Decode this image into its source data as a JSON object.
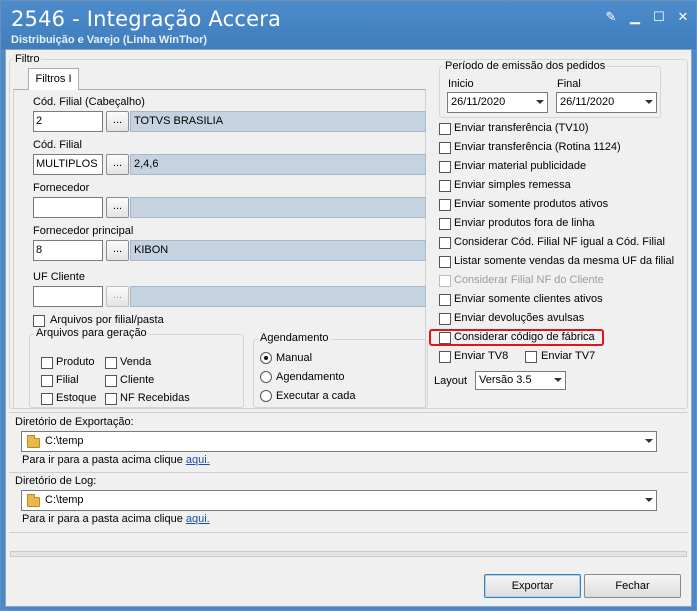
{
  "window": {
    "title": "2546 - Integração Accera",
    "subtitle": "Distribuição e Varejo (Linha WinThor)"
  },
  "filtro": {
    "legend": "Filtro",
    "tab_label": "Filtros I",
    "cod_filial_cab": {
      "label": "Cód. Filial (Cabeçalho)",
      "value": "2",
      "button": "...",
      "description": "TOTVS BRASILIA"
    },
    "cod_filial": {
      "label": "Cód. Filial",
      "value": "MULTIPLOS",
      "button": "...",
      "description": "2,4,6"
    },
    "fornecedor": {
      "label": "Fornecedor",
      "value": "",
      "button": "...",
      "description": ""
    },
    "fornecedor_principal": {
      "label": "Fornecedor principal",
      "value": "8",
      "button": "...",
      "description": "KIBON"
    },
    "uf_cliente": {
      "label": "UF Cliente",
      "value": "",
      "button": "...",
      "description": ""
    },
    "arquivos_por_filial": "Arquivos por filial/pasta",
    "arquivos_geracao": {
      "legend": "Arquivos para geração",
      "items": [
        "Produto",
        "Venda",
        "Filial",
        "Cliente",
        "Estoque",
        "NF Recebidas"
      ]
    },
    "agendamento": {
      "legend": "Agendamento",
      "options": [
        "Manual",
        "Agendamento",
        "Executar a cada"
      ],
      "selected": "Manual"
    }
  },
  "periodo": {
    "legend": "Período de emissão dos pedidos",
    "inicio_label": "Inicio",
    "inicio_value": "26/11/2020",
    "final_label": "Final",
    "final_value": "26/11/2020"
  },
  "options": {
    "checks": [
      {
        "label": "Enviar transferência (TV10)",
        "disabled": false
      },
      {
        "label": "Enviar transferência (Rotina 1124)",
        "disabled": false
      },
      {
        "label": "Enviar material publicidade",
        "disabled": false
      },
      {
        "label": "Enviar simples remessa",
        "disabled": false
      },
      {
        "label": "Enviar somente produtos ativos",
        "disabled": false
      },
      {
        "label": "Enviar produtos fora de linha",
        "disabled": false
      },
      {
        "label": "Considerar Cód. Filial NF igual a Cód. Filial",
        "disabled": false
      },
      {
        "label": "Listar somente vendas da mesma UF da filial",
        "disabled": false
      },
      {
        "label": "Considerar Filial NF do Cliente",
        "disabled": true
      },
      {
        "label": "Enviar somente clientes ativos",
        "disabled": false
      },
      {
        "label": "Enviar devoluções avulsas",
        "disabled": false
      },
      {
        "label": "Considerar código de fábrica",
        "disabled": false
      }
    ],
    "tv8": "Enviar TV8",
    "tv7": "Enviar TV7",
    "layout_label": "Layout",
    "layout_value": "Versão 3.5"
  },
  "export_dir": {
    "label": "Diretório de Exportação:",
    "path": "C:\\temp",
    "hint": "Para ir para a pasta acima clique",
    "link": "aqui."
  },
  "log_dir": {
    "label": "Diretório de Log:",
    "path": "C:\\temp",
    "hint": "Para ir para a pasta acima clique",
    "link": "aqui."
  },
  "buttons": {
    "exportar": "Exportar",
    "fechar": "Fechar"
  },
  "colors": {
    "titlebar": "#4a89c9",
    "highlight": "#e0151b",
    "description_bg": "#c5d3e0"
  }
}
